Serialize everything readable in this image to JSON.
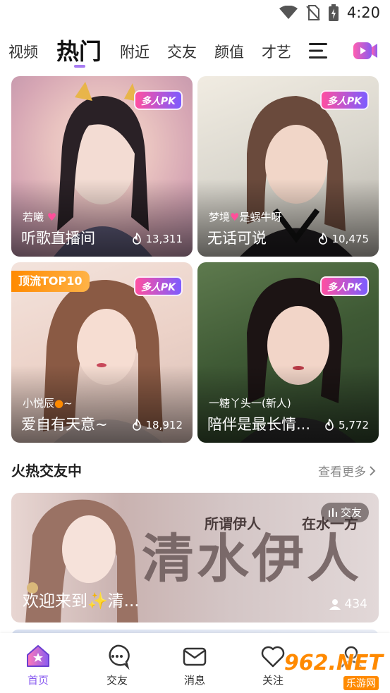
{
  "status_bar": {
    "time": "4:20"
  },
  "tabs": [
    {
      "label": "视频"
    },
    {
      "label": "热门"
    },
    {
      "label": "附近"
    },
    {
      "label": "交友"
    },
    {
      "label": "颜值"
    },
    {
      "label": "才艺"
    }
  ],
  "cards": [
    {
      "host": "若曦",
      "title": "听歌直播间",
      "heat": "13,311",
      "badge": "多人PK"
    },
    {
      "host": "梦境",
      "host_suffix": "是蜗牛呀",
      "title": "无话可说",
      "heat": "10,475",
      "badge": "多人PK"
    },
    {
      "host": "小悦辰",
      "host_suffix": "~",
      "title": "爱自有天意~",
      "heat": "18,912",
      "badge": "多人PK",
      "top_badge": "顶流TOP10"
    },
    {
      "host": "一糖丫头一(新人)",
      "title": "陪伴是最长情...",
      "heat": "5,772",
      "badge": "多人PK"
    }
  ],
  "section": {
    "title": "火热交友中",
    "more": "查看更多"
  },
  "banner": {
    "title": "欢迎来到✨清...",
    "count": "434",
    "badge": "交友",
    "art_big": "清水伊人",
    "art_small_1": "所谓伊人",
    "art_small_2": "在水一方"
  },
  "bottom_nav": [
    {
      "label": "首页"
    },
    {
      "label": "交友"
    },
    {
      "label": "消息"
    },
    {
      "label": "关注"
    }
  ],
  "watermark": {
    "number": "962.NET",
    "sub": "乐游网"
  },
  "colors": {
    "accent": "#8a5cf0",
    "pk_gradient_start": "#ff4fa0",
    "pk_gradient_end": "#7c5cff",
    "top_badge": "#ff8a00"
  }
}
